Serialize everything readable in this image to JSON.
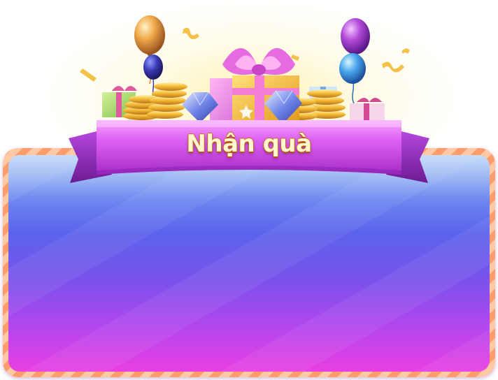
{
  "dialog": {
    "title": "Nhận quà"
  },
  "decorations": {
    "balloons": [
      "balloon-gold",
      "balloon-navy",
      "balloon-purple",
      "balloon-blue"
    ],
    "items": [
      "gift-box-icon",
      "gold-coins-icon",
      "diamond-icon",
      "confetti-icon"
    ]
  },
  "colors": {
    "ribbon": "#c640e6",
    "panel_top": "#a6c8f6",
    "panel_bottom": "#e93fe2",
    "frame": "#ff9c6b",
    "title_text": "#fff6cf"
  }
}
